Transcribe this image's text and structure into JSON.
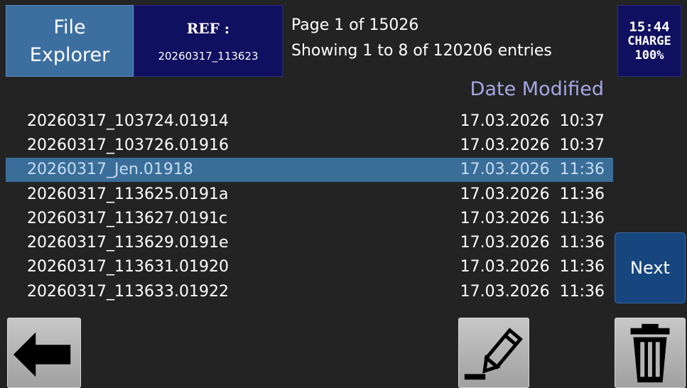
{
  "header": {
    "title_line1": "File",
    "title_line2": "Explorer",
    "ref_label": "REF :",
    "ref_value": "20260317_113623",
    "page_text": "Page 1 of 15026",
    "showing_text": "Showing 1 to 8 of 120206 entries"
  },
  "status": {
    "time": "15:44",
    "charge_label": "CHARGE",
    "charge_level": "100%"
  },
  "list": {
    "date_column_header": "Date Modified",
    "files": [
      {
        "name": "20260317_103724.01914",
        "date": "17.03.2026  10:37",
        "selected": false
      },
      {
        "name": "20260317_103726.01916",
        "date": "17.03.2026  10:37",
        "selected": false
      },
      {
        "name": "20260317_Jen.01918",
        "date": "17.03.2026  11:36",
        "selected": true
      },
      {
        "name": "20260317_113625.0191a",
        "date": "17.03.2026  11:36",
        "selected": false
      },
      {
        "name": "20260317_113627.0191c",
        "date": "17.03.2026  11:36",
        "selected": false
      },
      {
        "name": "20260317_113629.0191e",
        "date": "17.03.2026  11:36",
        "selected": false
      },
      {
        "name": "20260317_113631.01920",
        "date": "17.03.2026  11:36",
        "selected": false
      },
      {
        "name": "20260317_113633.01922",
        "date": "17.03.2026  11:36",
        "selected": false
      }
    ]
  },
  "buttons": {
    "next_label": "Next",
    "back_icon": "arrow-left-icon",
    "edit_icon": "pencil-icon",
    "delete_icon": "trash-icon"
  },
  "colors": {
    "background": "#232323",
    "title_box": "#3c6ea0",
    "ref_box": "#101060",
    "selected_row": "#3a6e99",
    "date_header": "#a7a7e6",
    "next_button": "#17467e"
  }
}
